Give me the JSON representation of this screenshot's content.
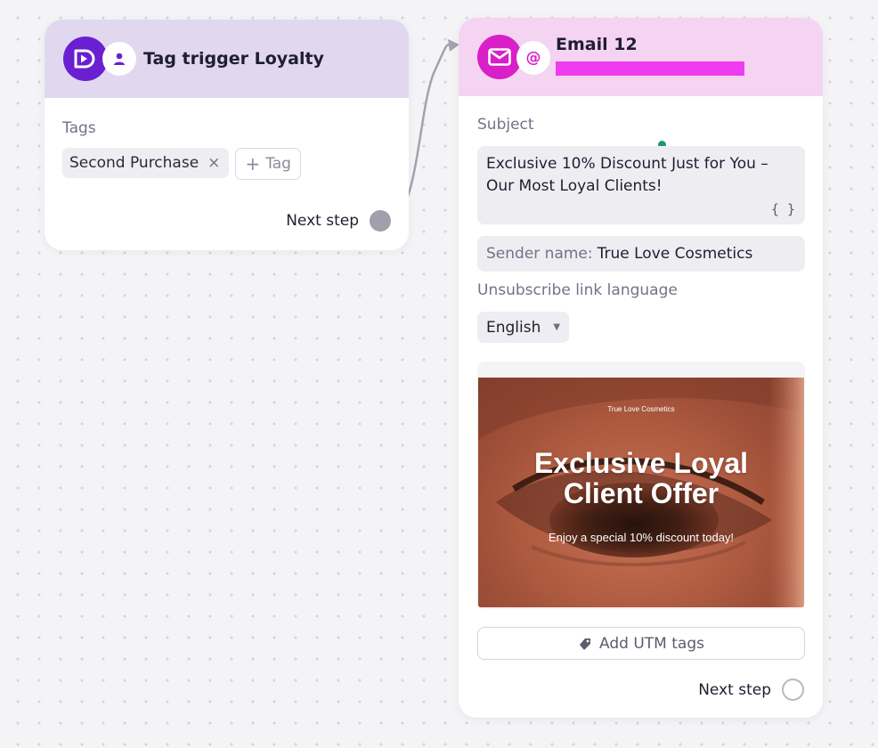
{
  "trigger_node": {
    "title": "Tag trigger Loyalty",
    "tags_label": "Tags",
    "tags": [
      {
        "label": "Second Purchase",
        "remove_icon": "×"
      }
    ],
    "add_tag_label": "Tag",
    "add_tag_icon": "+",
    "next_step_label": "Next step",
    "icons": {
      "main": "play-trigger-icon",
      "sub": "user-icon"
    },
    "colors": {
      "header_bg": "#e1d8f0",
      "main_icon_bg": "#6a1fd0"
    }
  },
  "email_node": {
    "title": "Email 12",
    "subject_label": "Subject",
    "subject_text": "Exclusive 10% Discount Just for You – Our Most Loyal Clients!",
    "variables_icon": "{ }",
    "sender_label": "Sender name:",
    "sender_value": "True Love Cosmetics",
    "unsubscribe_label": "Unsubscribe link language",
    "language_value": "English",
    "preview": {
      "brand": "True Love Cosmetics",
      "headline_line1": "Exclusive Loyal",
      "headline_line2": "Client Offer",
      "offer": "Enjoy a special 10% discount today!"
    },
    "utm_button_label": "Add UTM tags",
    "next_step_label": "Next step",
    "icons": {
      "main": "envelope-icon",
      "sub": "at-sign-icon",
      "utm": "tag-icon",
      "caret": "caret-down-icon"
    },
    "colors": {
      "header_bg": "#f4d4f0",
      "main_icon_bg": "#d81fc8",
      "redaction": "#f03cf0"
    }
  }
}
